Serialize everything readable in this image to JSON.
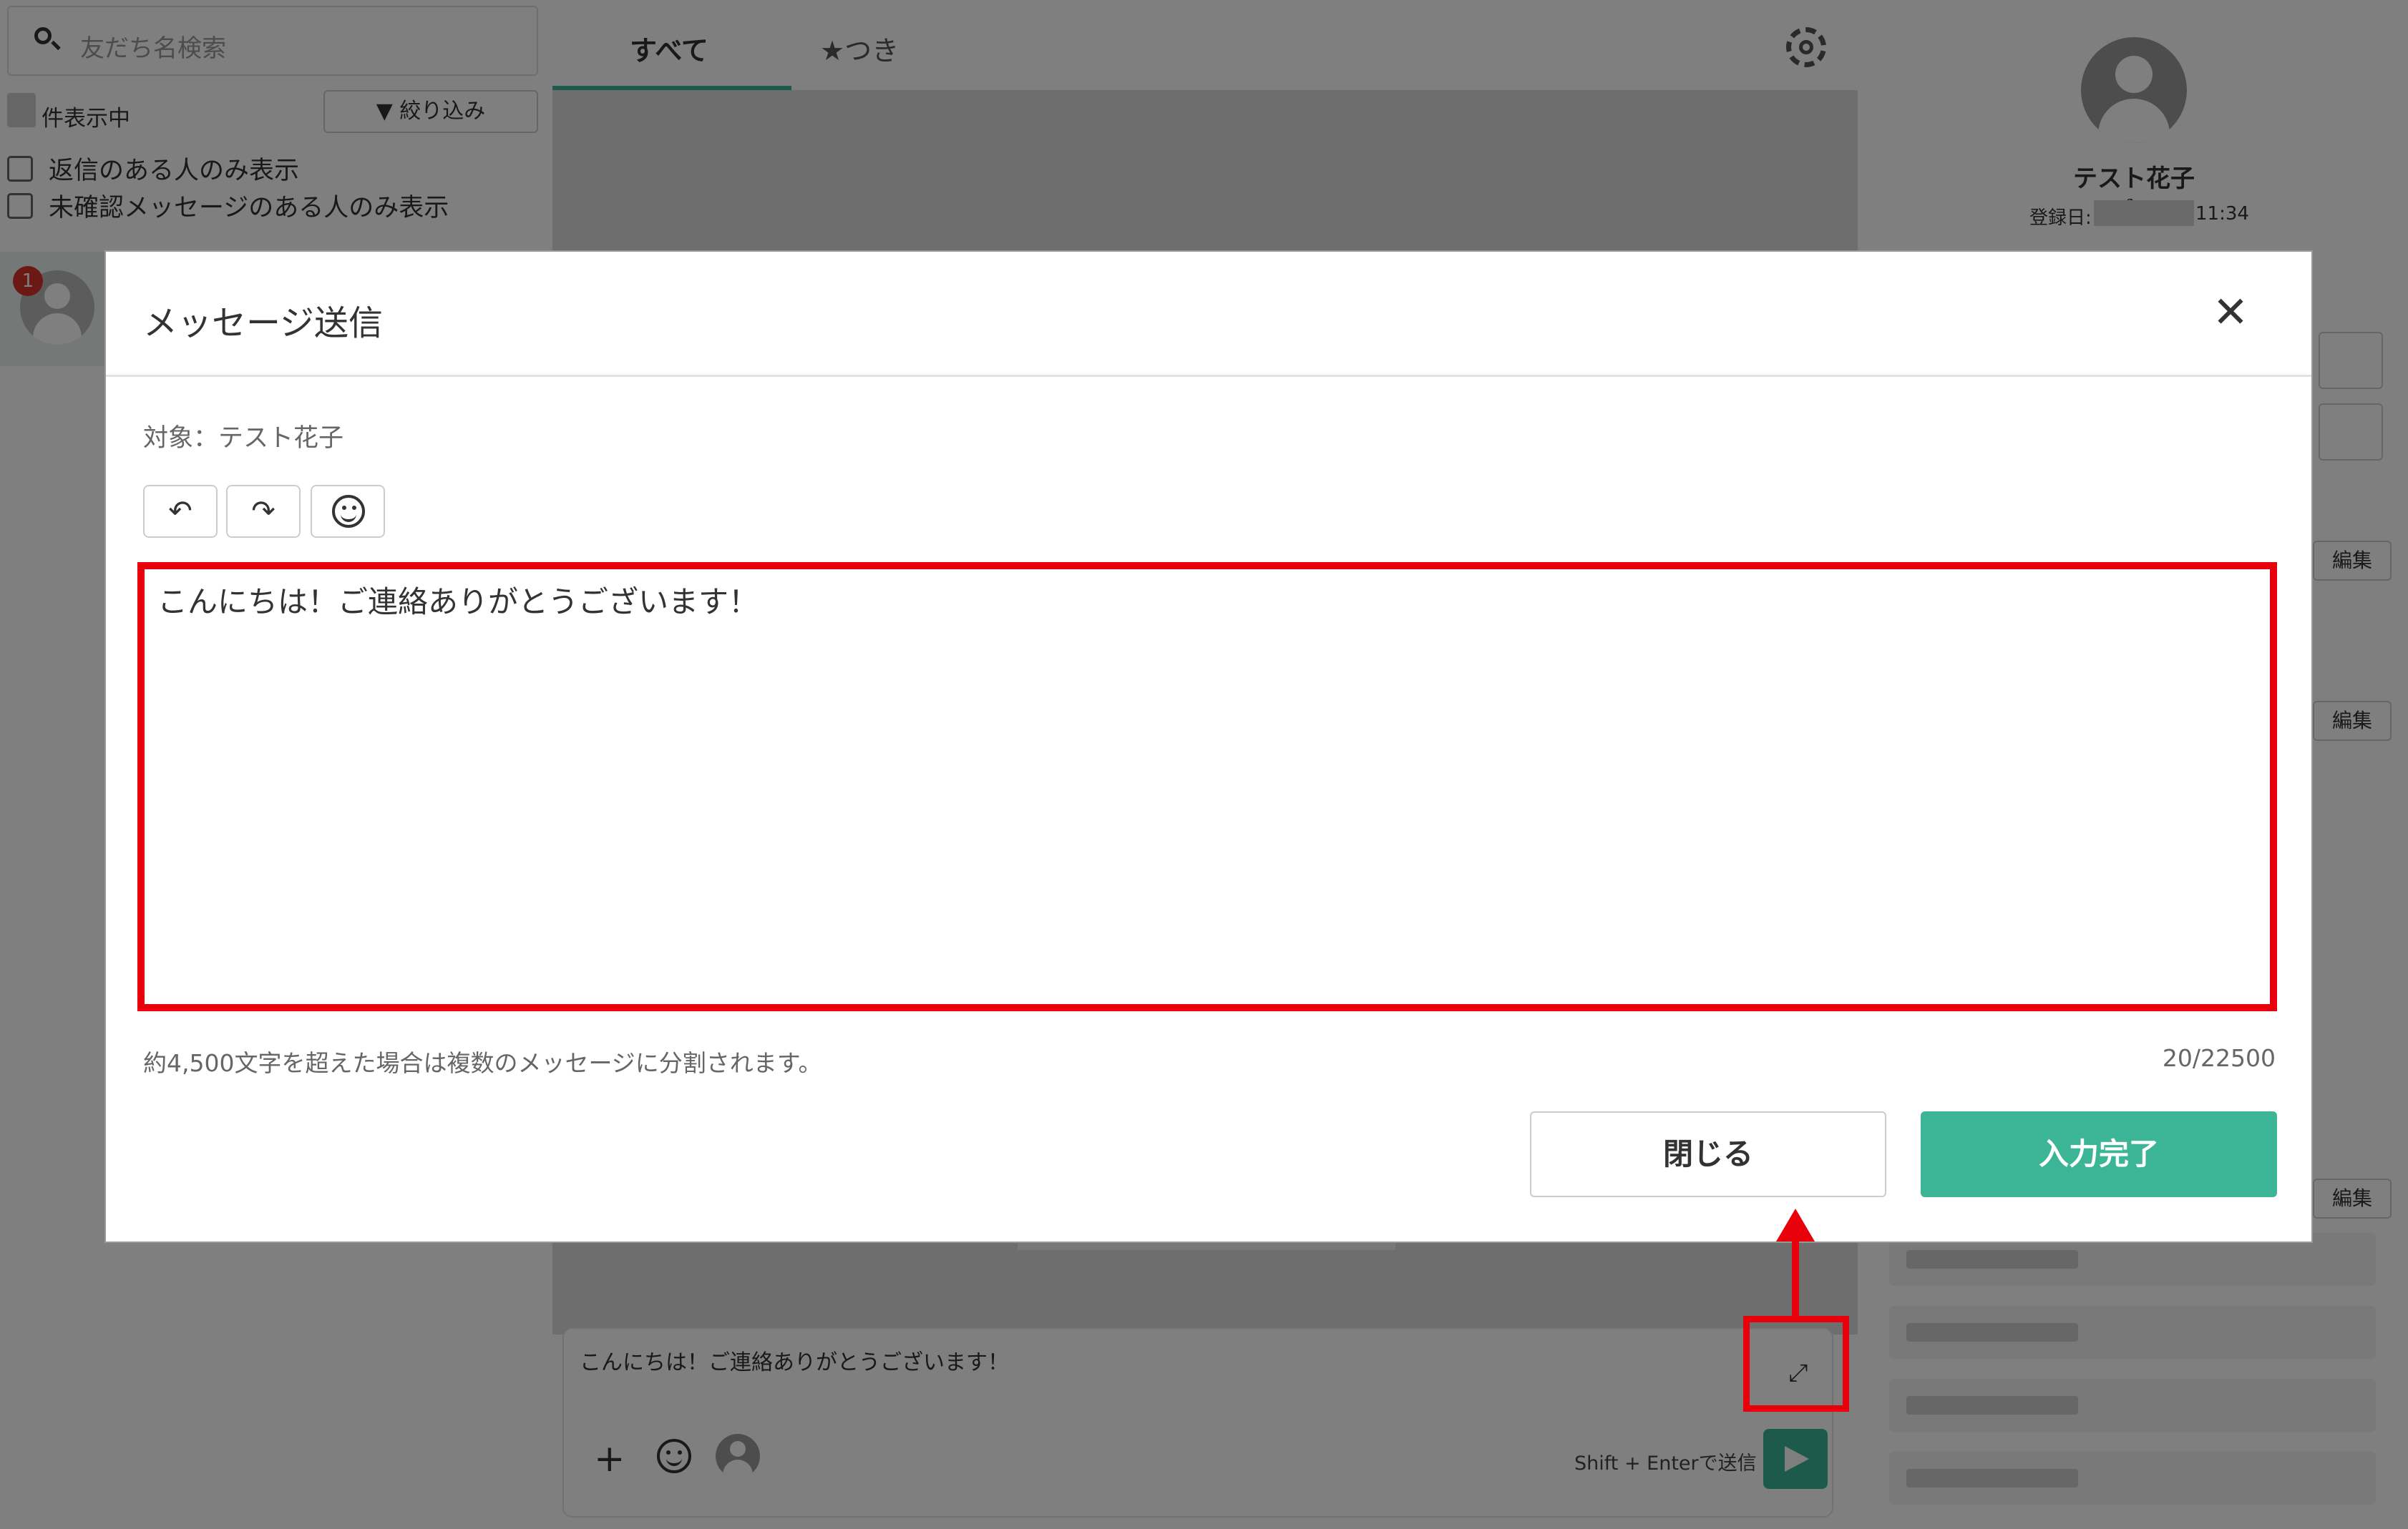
{
  "left_panel": {
    "search_placeholder": "友だち名検索",
    "count_suffix": "件表示中",
    "filter_label": "▼ 絞り込み",
    "checkbox_reply_only": "返信のある人のみ表示",
    "checkbox_unread_only": "未確認メッセージのある人のみ表示",
    "unread_badge": "1"
  },
  "chat": {
    "tabs": [
      {
        "label": "すべて",
        "active": true
      },
      {
        "label": "★つき",
        "active": false
      }
    ],
    "composer_text": "こんにちは！ご連絡ありがとうございます！",
    "send_hint": "Shift + Enterで送信",
    "icons": [
      "gear-icon",
      "expand-icon",
      "plus-icon",
      "smile-icon",
      "send-icon"
    ]
  },
  "profile": {
    "name": "テスト花子",
    "registered_label": "登録日:",
    "registered_time": "11:34",
    "edit_label": "編集"
  },
  "modal": {
    "title": "メッセージ送信",
    "target_label": "対象：テスト花子",
    "message_text": "こんにちは！ご連絡ありがとうございます！",
    "hint": "約4,500文字を超えた場合は複数のメッセージに分割されます。",
    "counter": "20/22500",
    "close_button": "閉じる",
    "done_button": "入力完了",
    "toolbar": {
      "undo_icon": "↶",
      "redo_icon": "↷"
    }
  },
  "colors": {
    "accent": "#3cb496",
    "annotation": "#e8000b",
    "badge": "#d9302b"
  }
}
